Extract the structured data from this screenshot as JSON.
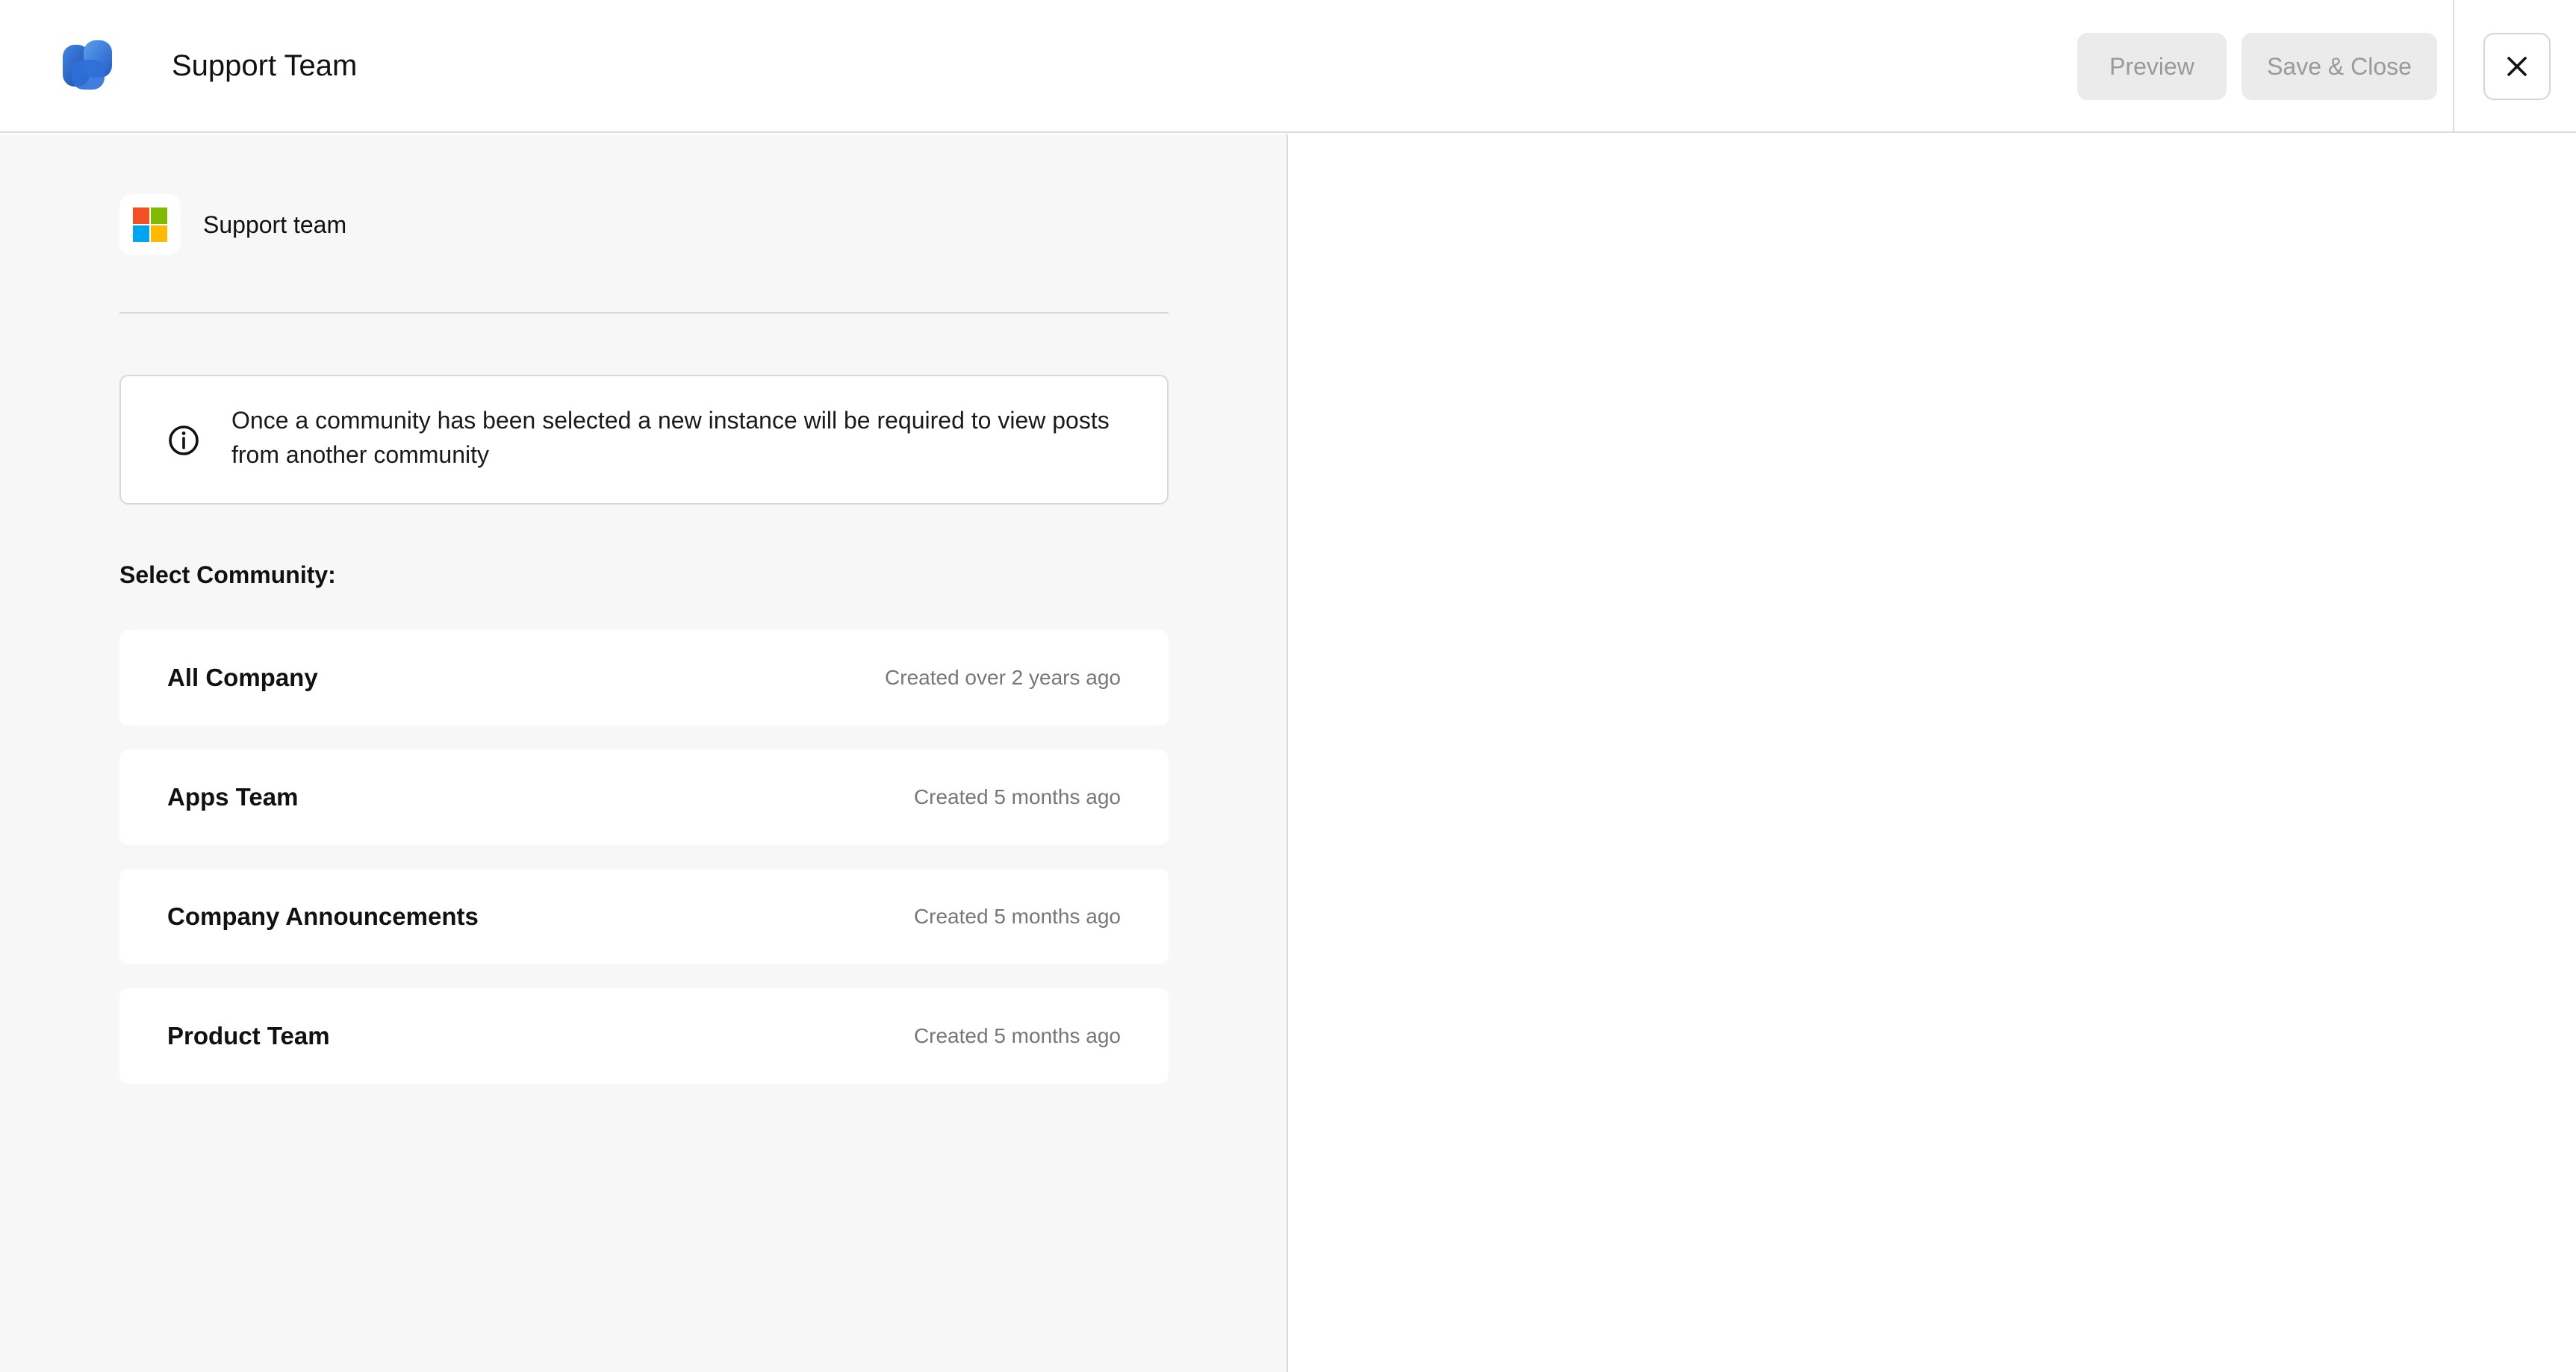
{
  "header": {
    "title": "Support Team",
    "preview_label": "Preview",
    "save_close_label": "Save & Close",
    "logo_icon": "app-logo-icon",
    "close_icon": "close-icon"
  },
  "team": {
    "name": "Support team",
    "logo_icon": "microsoft-logo-icon"
  },
  "info": {
    "icon": "info-icon",
    "text": "Once a community has been selected a new instance will be required to view posts from another community"
  },
  "community_section": {
    "label": "Select Community:",
    "items": [
      {
        "name": "All Company",
        "created": "Created over 2 years ago"
      },
      {
        "name": "Apps Team",
        "created": "Created 5 months ago"
      },
      {
        "name": "Company Announcements",
        "created": "Created 5 months ago"
      },
      {
        "name": "Product Team",
        "created": "Created 5 months ago"
      }
    ]
  },
  "colors": {
    "brand_blue": "#3a7bd5",
    "panel_bg": "#f7f7f7",
    "button_disabled_bg": "#ebebeb",
    "button_disabled_text": "#9a9a9a"
  }
}
